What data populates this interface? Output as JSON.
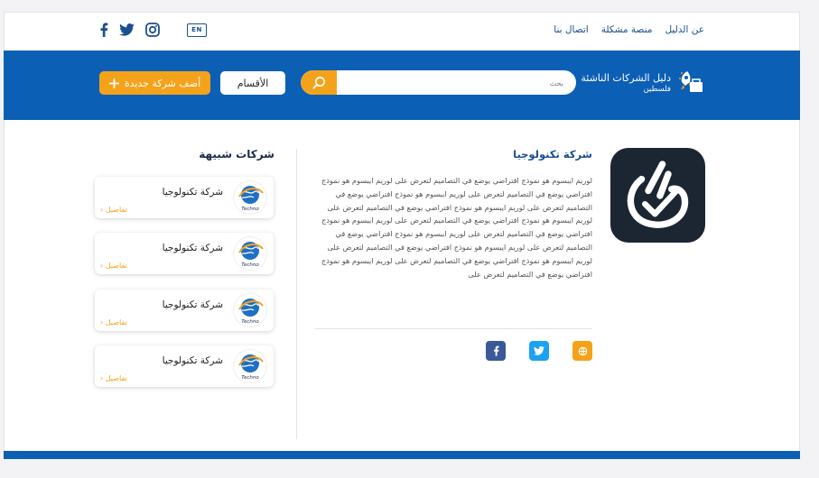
{
  "topnav": {
    "items": [
      {
        "label": "عن الدليل"
      },
      {
        "label": "منصة مشكلة"
      },
      {
        "label": "اتصال بنا"
      }
    ]
  },
  "lang_label": "EN",
  "social": [
    "facebook-icon",
    "twitter-icon",
    "instagram-icon"
  ],
  "brand": {
    "title": "دليل الشركات الناشئة",
    "subtitle": "فلسطين"
  },
  "search": {
    "placeholder": "بحث"
  },
  "buttons": {
    "categories": "الأقسام",
    "add_company": "أضف شركة جديدة"
  },
  "company": {
    "name": "شركة تكنولوجيا",
    "description": "لوريم ايبسوم هو نموذج افتراضي يوضع في التصاميم لتعرض على  لوريم ايبسوم هو نموذج افتراضي يوضع في التصاميم لتعرض على  لوريم ايبسوم هو نموذج افتراضي يوضع في التصاميم لتعرض على  لوريم ايبسوم هو نموذج افتراضي يوضع في التصاميم لتعرض على  لوريم ايبسوم هو نموذج افتراضي يوضع في التصاميم لتعرض على لوريم ايبسوم هو نموذج افتراضي يوضع في التصاميم لتعرض على  لوريم ايبسوم هو نموذج افتراضي يوضع في التصاميم لتعرض على  لوريم ايبسوم هو نموذج افتراضي يوضع في التصاميم لتعرض على لوريم ايبسوم هو نموذج افتراضي يوضع في التصاميم لتعرض على  لوريم ايبسوم هو نموذج افتراضي يوضع في التصاميم لتعرض على"
  },
  "share": [
    "website-icon",
    "twitter-icon",
    "facebook-icon"
  ],
  "similar": {
    "title": "شركات شبيهة",
    "cards": [
      {
        "name": "شركة تكنولوجيا",
        "link": "تفاصيل",
        "logo_text": "Techno"
      },
      {
        "name": "شركة تكنولوجيا",
        "link": "تفاصيل",
        "logo_text": "Techno"
      },
      {
        "name": "شركة تكنولوجيا",
        "link": "تفاصيل",
        "logo_text": "Techno"
      },
      {
        "name": "شركة تكنولوجيا",
        "link": "تفاصيل",
        "logo_text": "Techno"
      }
    ]
  },
  "colors": {
    "primary": "#0b5fb5",
    "accent": "#f5a21b",
    "link": "#1b4f8f"
  }
}
